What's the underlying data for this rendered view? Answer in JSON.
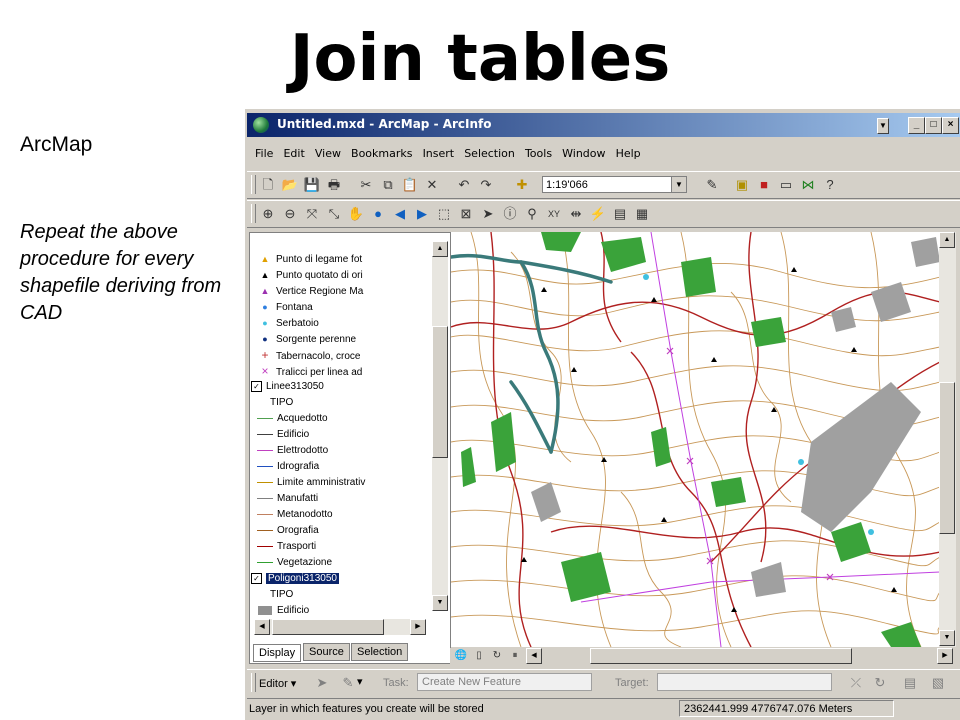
{
  "slide": {
    "title": "Join tables",
    "side_label": "ArcMap",
    "side_note": "Repeat the above procedure for every shapefile deriving from CAD"
  },
  "window": {
    "title": "Untitled.mxd - ArcMap - ArcInfo",
    "controls": [
      "_",
      "□",
      "×"
    ]
  },
  "menu": [
    "File",
    "Edit",
    "View",
    "Bookmarks",
    "Insert",
    "Selection",
    "Tools",
    "Window",
    "Help"
  ],
  "toolbar": {
    "scale_value": "1:19'066"
  },
  "toc": {
    "point_items": [
      {
        "label": "Punto di legame fot",
        "symbol": "▲",
        "color": "#e0a000"
      },
      {
        "label": "Punto quotato di ori",
        "symbol": "▲",
        "color": "#000000"
      },
      {
        "label": "Vertice Regione Ma",
        "symbol": "▲",
        "color": "#9b30b0"
      },
      {
        "label": "Fontana",
        "symbol": "●",
        "color": "#2f7fe0"
      },
      {
        "label": "Serbatoio",
        "symbol": "●",
        "color": "#40c0e0"
      },
      {
        "label": "Sorgente perenne",
        "symbol": "●",
        "color": "#103080"
      },
      {
        "label": "Tabernacolo, croce",
        "symbol": "+",
        "color": "#c03030"
      },
      {
        "label": "Tralicci per linea ad",
        "symbol": "×",
        "color": "#c040c0"
      }
    ],
    "layer_lines": {
      "name": "Linee313050",
      "field": "TIPO",
      "items": [
        {
          "label": "Acquedotto",
          "color": "#50a050"
        },
        {
          "label": "Edificio",
          "color": "#404040"
        },
        {
          "label": "Elettrodotto",
          "color": "#c040c0"
        },
        {
          "label": "Idrografia",
          "color": "#2050c0"
        },
        {
          "label": "Limite amministrativ",
          "color": "#c09000"
        },
        {
          "label": "Manufatti",
          "color": "#808080"
        },
        {
          "label": "Metanodotto",
          "color": "#c08060"
        },
        {
          "label": "Orografia",
          "color": "#a06020"
        },
        {
          "label": "Trasporti",
          "color": "#a00000"
        },
        {
          "label": "Vegetazione",
          "color": "#30a030"
        }
      ]
    },
    "layer_polygons": {
      "name": "Poligoni313050",
      "field": "TIPO",
      "items": [
        {
          "label": "Edificio",
          "color": "#909090"
        }
      ]
    },
    "tabs": [
      "Display",
      "Source",
      "Selection"
    ]
  },
  "editor": {
    "editor_label": "Editor",
    "task_label": "Task:",
    "task_value": "Create New Feature",
    "target_label": "Target:"
  },
  "status": {
    "message": "Layer in which features you create will be stored",
    "coordinates": "2362441.999  4776747.076 Meters"
  },
  "colors": {
    "title_bar": "#0a246a",
    "contour": "#c89858",
    "road": "#b02020",
    "river": "#3a7a7a",
    "vegetation": "#3aa33a",
    "building": "#a0a0a0",
    "powerline": "#c040e0"
  }
}
